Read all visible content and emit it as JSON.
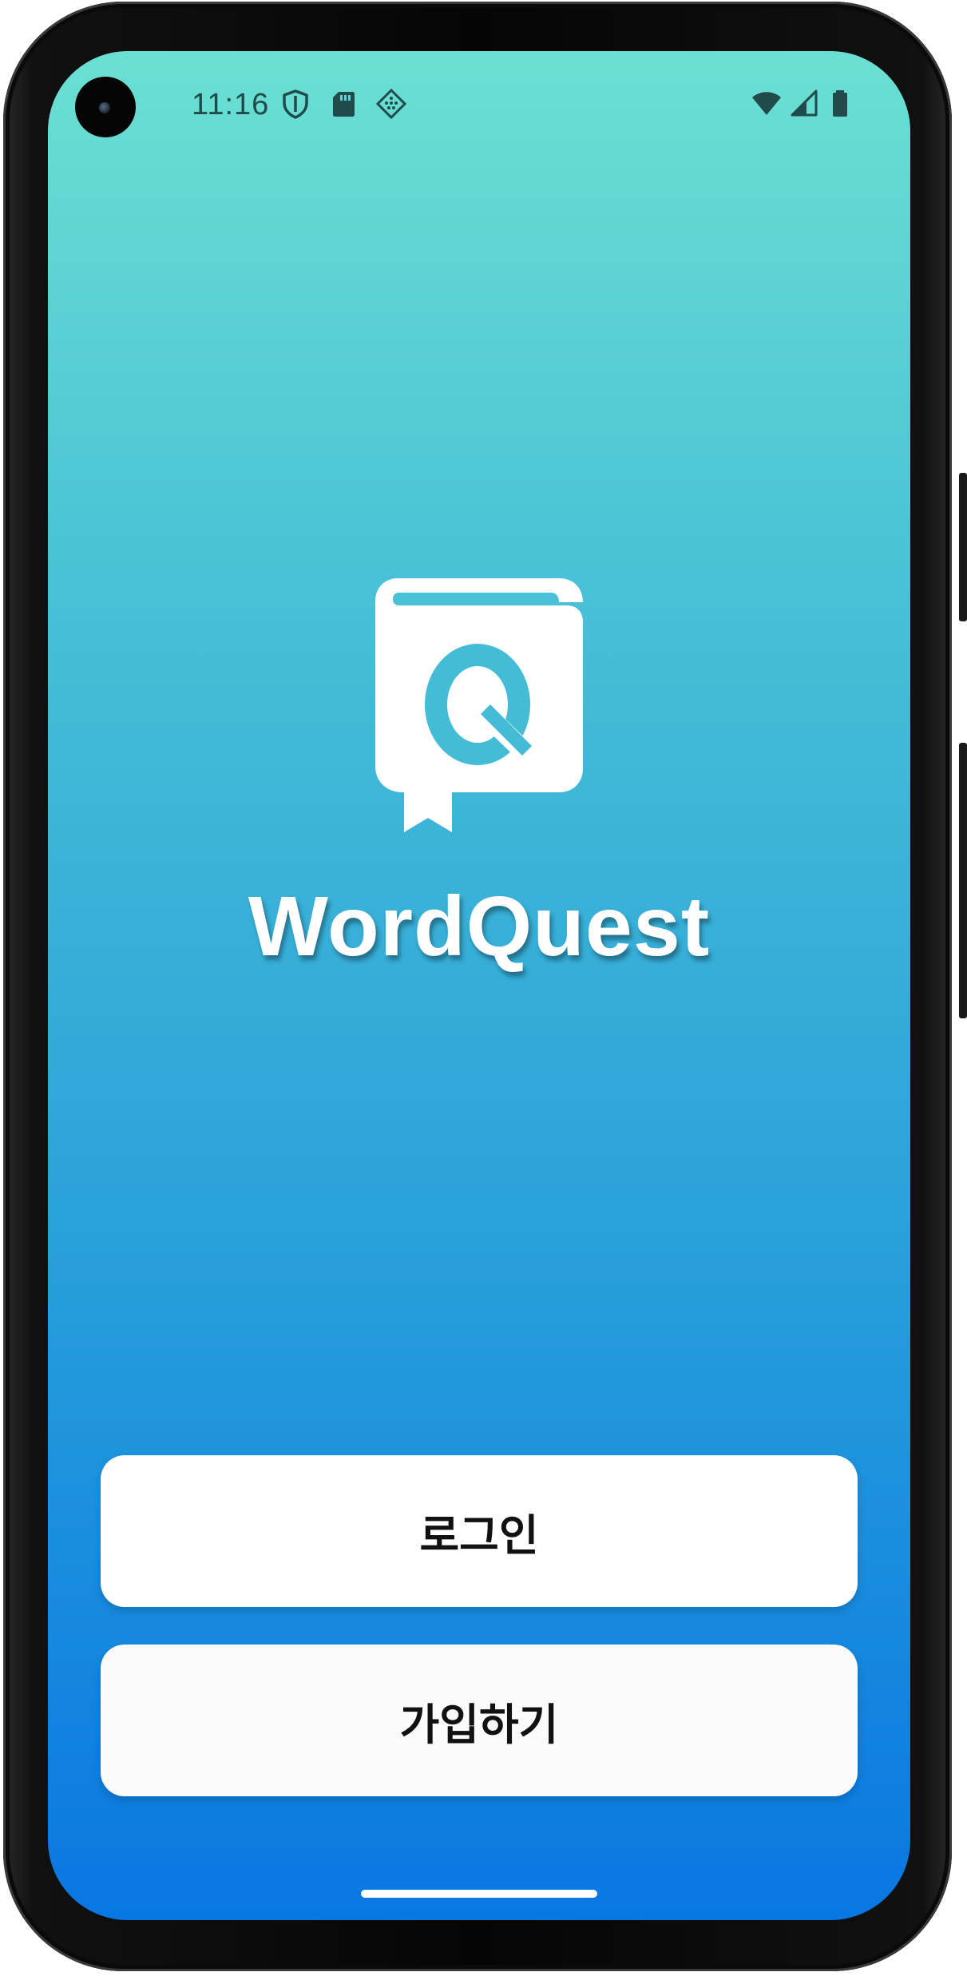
{
  "status_bar": {
    "time": "11:16",
    "left_icons": [
      "shield-icon",
      "sd-card-icon",
      "tile-grid-icon"
    ],
    "right_icons": [
      "wifi-icon",
      "cell-signal-icon",
      "battery-icon"
    ]
  },
  "app": {
    "logo_icon": "book-q-logo-icon",
    "logo_letter": "Q",
    "title": "WordQuest"
  },
  "actions": {
    "login_label": "로그인",
    "signup_label": "가입하기"
  },
  "colors": {
    "gradient_top": "#6be0d2",
    "gradient_bottom": "#0877e2",
    "logo_accent": "#44bcd6",
    "button_bg": "#ffffff",
    "button_text": "#111111"
  }
}
